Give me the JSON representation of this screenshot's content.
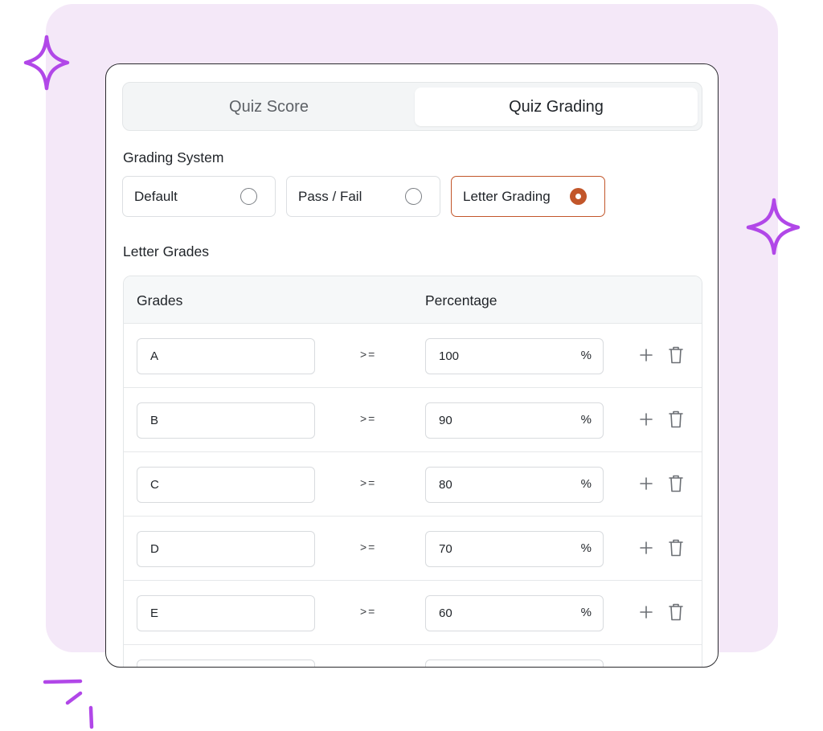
{
  "tabs": [
    {
      "label": "Quiz Score",
      "active": false
    },
    {
      "label": "Quiz Grading",
      "active": true
    }
  ],
  "grading_system": {
    "label": "Grading System",
    "options": [
      {
        "label": "Default",
        "selected": false
      },
      {
        "label": "Pass / Fail",
        "selected": false
      },
      {
        "label": "Letter Grading",
        "selected": true
      }
    ]
  },
  "letter_grades": {
    "label": "Letter Grades",
    "columns": [
      "Grades",
      "Percentage"
    ],
    "comparator": ">=",
    "unit": "%",
    "rows": [
      {
        "grade": "A",
        "percentage": "100"
      },
      {
        "grade": "B",
        "percentage": "90"
      },
      {
        "grade": "C",
        "percentage": "80"
      },
      {
        "grade": "D",
        "percentage": "70"
      },
      {
        "grade": "E",
        "percentage": "60"
      },
      {
        "grade": "",
        "percentage": ""
      }
    ]
  },
  "icons": {
    "add": "plus-icon",
    "delete": "trash-icon"
  },
  "colors": {
    "accent": "#c2562a",
    "background_panel": "#f4e8f8",
    "sparkle": "#b147e8"
  }
}
